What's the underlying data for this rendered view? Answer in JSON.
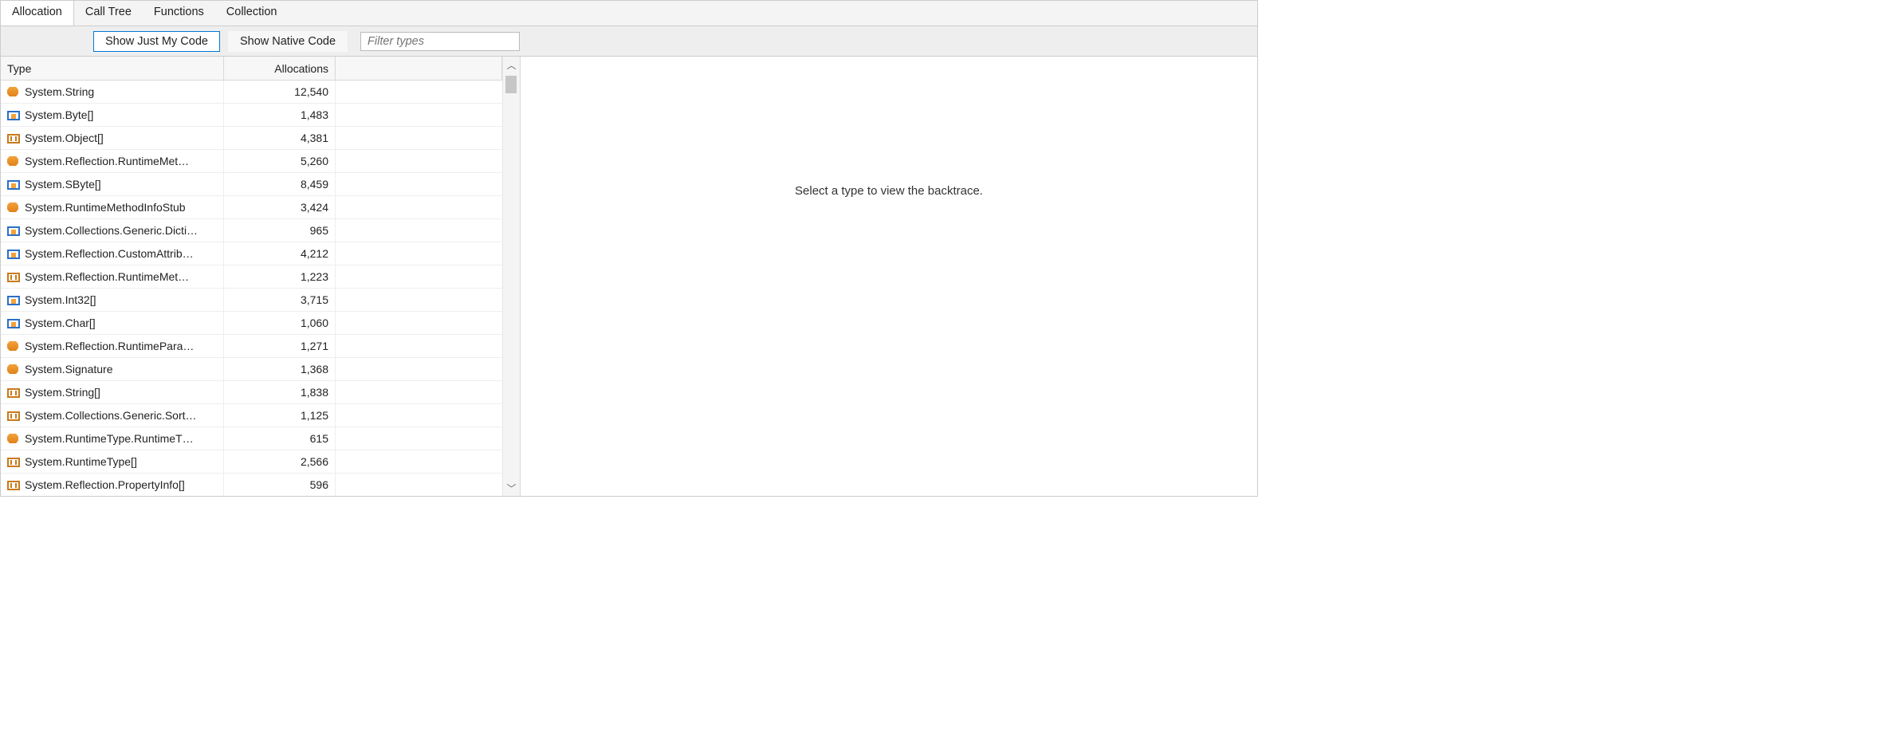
{
  "tabs": [
    "Allocation",
    "Call Tree",
    "Functions",
    "Collection"
  ],
  "activeTab": 0,
  "toolbar": {
    "showJustMyCode": "Show Just My Code",
    "showNativeCode": "Show Native Code",
    "filterPlaceholder": "Filter types"
  },
  "columns": {
    "type": "Type",
    "allocations": "Allocations"
  },
  "rightMessage": "Select a type to view the backtrace.",
  "rows": [
    {
      "icon": "class",
      "name": "System.String",
      "alloc": "12,540"
    },
    {
      "icon": "struct",
      "name": "System.Byte[]",
      "alloc": "1,483"
    },
    {
      "icon": "array",
      "name": "System.Object[]",
      "alloc": "4,381"
    },
    {
      "icon": "class",
      "name": "System.Reflection.RuntimeMet…",
      "alloc": "5,260"
    },
    {
      "icon": "struct",
      "name": "System.SByte[]",
      "alloc": "8,459"
    },
    {
      "icon": "class",
      "name": "System.RuntimeMethodInfoStub",
      "alloc": "3,424"
    },
    {
      "icon": "struct",
      "name": "System.Collections.Generic.Dicti…",
      "alloc": "965"
    },
    {
      "icon": "struct",
      "name": "System.Reflection.CustomAttrib…",
      "alloc": "4,212"
    },
    {
      "icon": "array",
      "name": "System.Reflection.RuntimeMet…",
      "alloc": "1,223"
    },
    {
      "icon": "struct",
      "name": "System.Int32[]",
      "alloc": "3,715"
    },
    {
      "icon": "struct",
      "name": "System.Char[]",
      "alloc": "1,060"
    },
    {
      "icon": "class",
      "name": "System.Reflection.RuntimePara…",
      "alloc": "1,271"
    },
    {
      "icon": "class",
      "name": "System.Signature",
      "alloc": "1,368"
    },
    {
      "icon": "array",
      "name": "System.String[]",
      "alloc": "1,838"
    },
    {
      "icon": "array",
      "name": "System.Collections.Generic.Sort…",
      "alloc": "1,125"
    },
    {
      "icon": "class",
      "name": "System.RuntimeType.RuntimeT…",
      "alloc": "615"
    },
    {
      "icon": "array",
      "name": "System.RuntimeType[]",
      "alloc": "2,566"
    },
    {
      "icon": "array",
      "name": "System.Reflection.PropertyInfo[]",
      "alloc": "596"
    }
  ]
}
